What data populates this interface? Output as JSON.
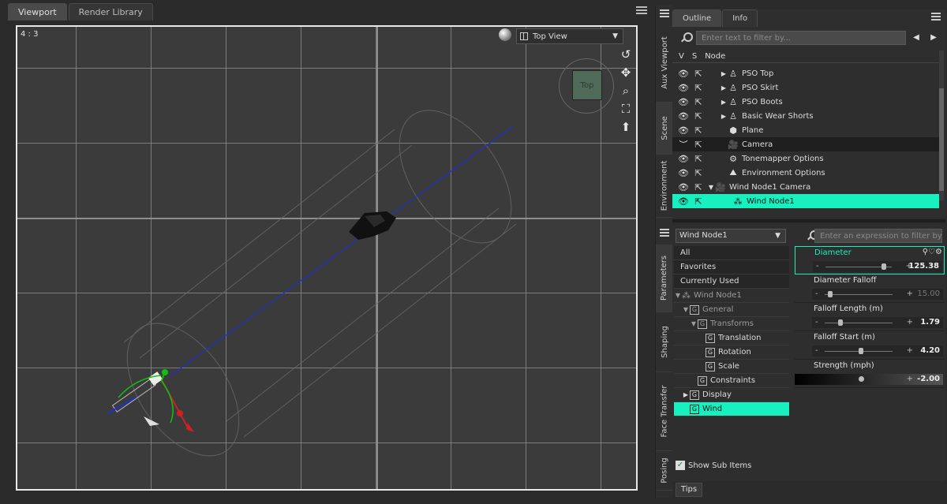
{
  "viewport": {
    "tabs": [
      "Viewport",
      "Render Library"
    ],
    "aspect": "4 : 3",
    "view": "Top View",
    "compass_label": "Top"
  },
  "side_tabs_top": [
    "Aux Viewport",
    "Scene",
    "Environment"
  ],
  "side_tabs_bottom": [
    "Parameters",
    "Shaping",
    "Face Transfer",
    "Posing"
  ],
  "outline": {
    "tabs": [
      "Outline",
      "Info"
    ],
    "filter_placeholder": "Enter text to filter by...",
    "columns": [
      "V",
      "S",
      "Node"
    ],
    "nodes": [
      {
        "label": "PSO Top",
        "icon": "figure-icon"
      },
      {
        "label": "PSO Skirt",
        "icon": "figure-icon"
      },
      {
        "label": "PSO Boots",
        "icon": "figure-icon"
      },
      {
        "label": "Basic Wear Shorts",
        "icon": "figure-icon"
      },
      {
        "label": "Plane",
        "icon": "primitive-icon"
      },
      {
        "label": "Camera",
        "icon": "camera-icon"
      },
      {
        "label": "Tonemapper Options",
        "icon": "tonemapper-icon"
      },
      {
        "label": "Environment Options",
        "icon": "environment-icon"
      },
      {
        "label": "Wind Node1 Camera",
        "icon": "camera-icon"
      },
      {
        "label": "Wind Node1",
        "icon": "wind-node-icon",
        "selected": true
      }
    ]
  },
  "parameters": {
    "node_select": "Wind Node1",
    "filter_placeholder": "Enter an expression to filter by...",
    "tree": {
      "all": "All",
      "favorites": "Favorites",
      "currently_used": "Currently Used",
      "root": "Wind Node1",
      "general": "General",
      "transforms": "Transforms",
      "translation": "Translation",
      "rotation": "Rotation",
      "scale": "Scale",
      "constraints": "Constraints",
      "display": "Display",
      "wind": "Wind",
      "group_letter": "G"
    },
    "properties": [
      {
        "name": "Diameter",
        "value": "125.38",
        "slider": 0.85
      },
      {
        "name": "Diameter Falloff",
        "value": "15.00",
        "slider": 0.05
      },
      {
        "name": "Falloff Length (m)",
        "value": "1.79",
        "slider": 0.2
      },
      {
        "name": "Falloff Start (m)",
        "value": "4.20",
        "slider": 0.5
      },
      {
        "name": "Strength (mph)",
        "value": "-2.00",
        "slider": 0.6
      }
    ],
    "show_sub_items": "Show Sub Items",
    "tips": "Tips"
  },
  "colors": {
    "accent": "#18f0c0",
    "axis_blue": "#2030d0",
    "grid": "#8e8e8e"
  }
}
